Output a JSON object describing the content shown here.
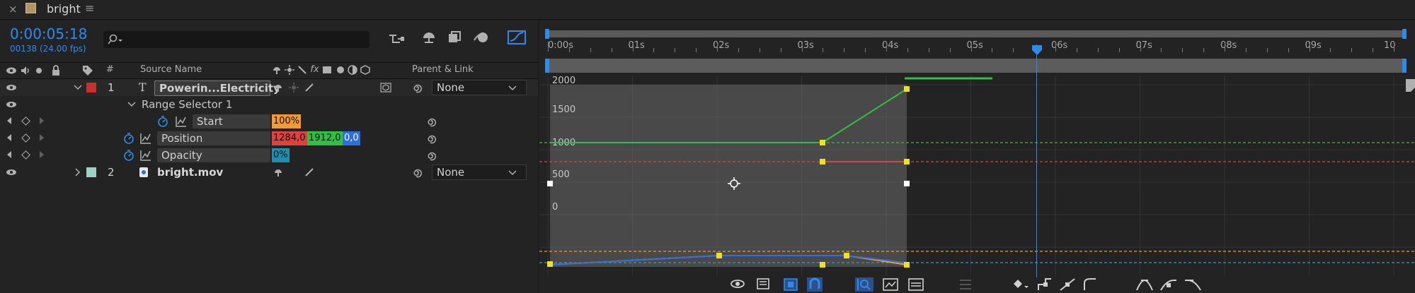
{
  "tab": {
    "title": "bright"
  },
  "time": {
    "timecode": "0:00:05:18",
    "frames": "00138 (24.00 fps)"
  },
  "search": {
    "placeholder": ""
  },
  "columns": {
    "source_name": "Source Name",
    "parent_link": "Parent & Link",
    "num": "#"
  },
  "layers": [
    {
      "num": "1",
      "name": "Powerin...Electricity",
      "parent": "None",
      "label_color": "#c8302c"
    },
    {
      "num": "2",
      "name": "bright.mov",
      "parent": "None",
      "label_color": "#9ecfc8"
    }
  ],
  "range_selector": {
    "label": "Range Selector 1"
  },
  "properties": {
    "start": {
      "label": "Start",
      "value": "100%"
    },
    "position": {
      "label": "Position",
      "x": "1284,0",
      "y": "1912,0",
      "z": "0,0"
    },
    "opacity": {
      "label": "Opacity",
      "value": "0%"
    }
  },
  "ruler": {
    "labels": [
      "0:00s",
      "01s",
      "02s",
      "03s",
      "04s",
      "05s",
      "06s",
      "07s",
      "08s",
      "09s",
      "10"
    ]
  },
  "graph": {
    "y_labels": [
      "2000",
      "1500",
      "1000",
      "500",
      "0"
    ]
  },
  "colors": {
    "accent": "#2d8ceb",
    "keyframe": "#f0e020",
    "red": "#e04040",
    "green": "#30c040",
    "blue": "#2d6fe0",
    "orange": "#f59a30"
  }
}
